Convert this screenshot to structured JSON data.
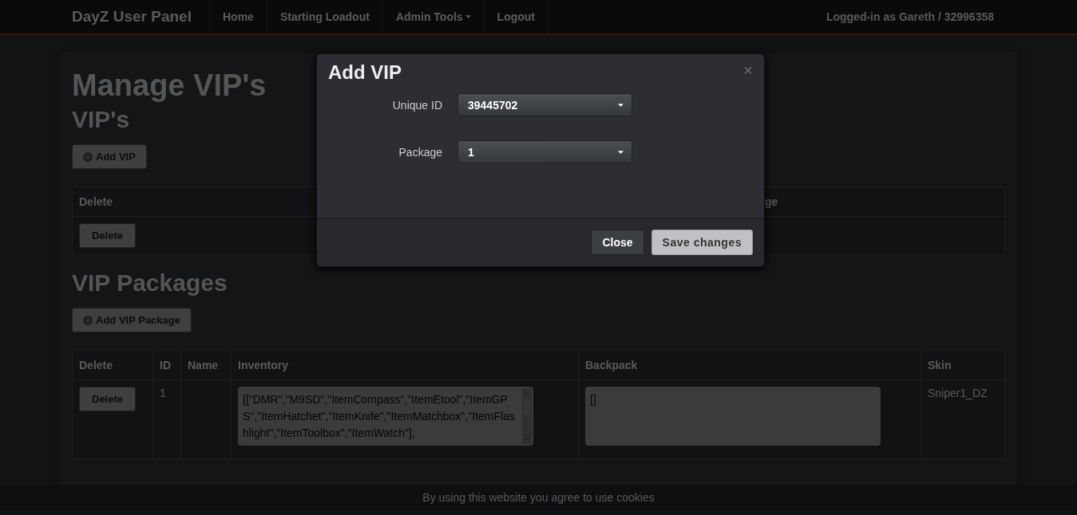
{
  "navbar": {
    "brand": "DayZ User Panel",
    "items": [
      {
        "label": "Home",
        "dropdown": false
      },
      {
        "label": "Starting Loadout",
        "dropdown": false
      },
      {
        "label": "Admin Tools",
        "dropdown": true
      },
      {
        "label": "Logout",
        "dropdown": false
      }
    ],
    "user": "Logged-in as Gareth / 32996358"
  },
  "page": {
    "title": "Manage VIP's",
    "vips": {
      "heading": "VIP's",
      "add_button": "Add VIP",
      "columns": [
        "Delete",
        "ge"
      ],
      "rows": [
        {
          "delete": "Delete"
        }
      ]
    },
    "packages": {
      "heading": "VIP Packages",
      "add_button": "Add VIP Package",
      "columns": [
        "Delete",
        "ID",
        "Name",
        "Inventory",
        "Backpack",
        "Skin"
      ],
      "rows": [
        {
          "delete": "Delete",
          "id": "1",
          "name": "",
          "inventory": "[[\"DMR\",\"M9SD\",\"ItemCompass\",\"ItemEtool\",\"ItemGPS\",\"ItemHatchet\",\"ItemKnife\",\"ItemMatchbox\",\"ItemFlashlight\",\"ItemToolbox\",\"ItemWatch\"],",
          "backpack": "[]",
          "skin": "Sniper1_DZ"
        }
      ]
    }
  },
  "modal": {
    "title": "Add VIP",
    "close": "×",
    "fields": [
      {
        "label": "Unique ID",
        "value": "39445702"
      },
      {
        "label": "Package",
        "value": "1"
      }
    ],
    "buttons": [
      {
        "label": "Close",
        "kind": "secondary"
      },
      {
        "label": "Save changes",
        "kind": "primary"
      }
    ]
  },
  "cookie_bar": "By using this website you agree to use cookies"
}
